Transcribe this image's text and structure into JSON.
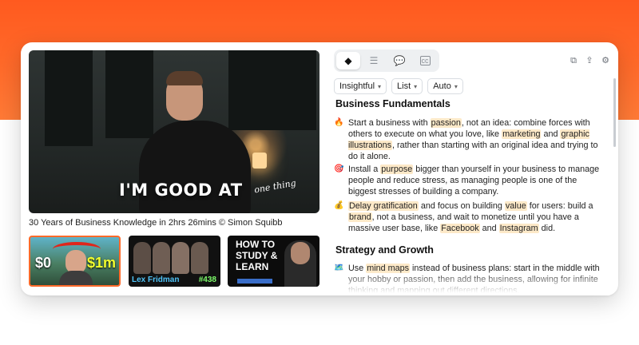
{
  "video": {
    "overlay_text": "I'M GOOD AT",
    "overlay_script": "one thing",
    "title": "30 Years of Business Knowledge in 2hrs 26mins © Simon Squibb"
  },
  "thumbnails": [
    {
      "left_text": "$0",
      "right_text": "$1m"
    },
    {
      "name_first": "Lex",
      "name_last": "Fridman",
      "episode": "#438"
    },
    {
      "text": "HOW TO STUDY & LEARN"
    }
  ],
  "tabs": [
    {
      "name": "summary-tab",
      "icon": "diamond-icon"
    },
    {
      "name": "list-tab",
      "icon": "list-icon"
    },
    {
      "name": "chat-tab",
      "icon": "chat-icon"
    },
    {
      "name": "captions-tab",
      "icon": "captions-icon"
    }
  ],
  "controls": {
    "style": "Insightful",
    "format": "List",
    "language": "Auto"
  },
  "sections": [
    {
      "heading": "Business Fundamentals",
      "items": [
        {
          "emoji": "🔥",
          "parts": [
            "Start a business with ",
            "passion",
            ", not an idea: combine forces with others to execute on what you love, like ",
            "marketing",
            " and ",
            "graphic illustrations",
            ", rather than starting with an original idea and trying to do it alone."
          ]
        },
        {
          "emoji": "🎯",
          "parts": [
            "Install a ",
            "purpose",
            " bigger than yourself in your business to manage people and reduce stress, as managing people is one of the biggest stresses of building a company."
          ]
        },
        {
          "emoji": "💰",
          "parts": [
            "",
            "Delay gratification",
            " and focus on building ",
            "value",
            " for users: build a ",
            "brand",
            ", not a business, and wait to monetize until you have a massive user base, like ",
            "Facebook",
            " and ",
            "Instagram",
            " did."
          ]
        }
      ]
    },
    {
      "heading": "Strategy and Growth",
      "items": [
        {
          "emoji": "🗺️",
          "parts": [
            "Use ",
            "mind maps",
            " instead of business plans: start in the middle with your hobby or passion, then add the business, allowing for infinite thinking and mapping out different directions."
          ]
        }
      ]
    }
  ],
  "colors": {
    "accent": "#ff5a1f",
    "highlight": "#fde9c8"
  }
}
